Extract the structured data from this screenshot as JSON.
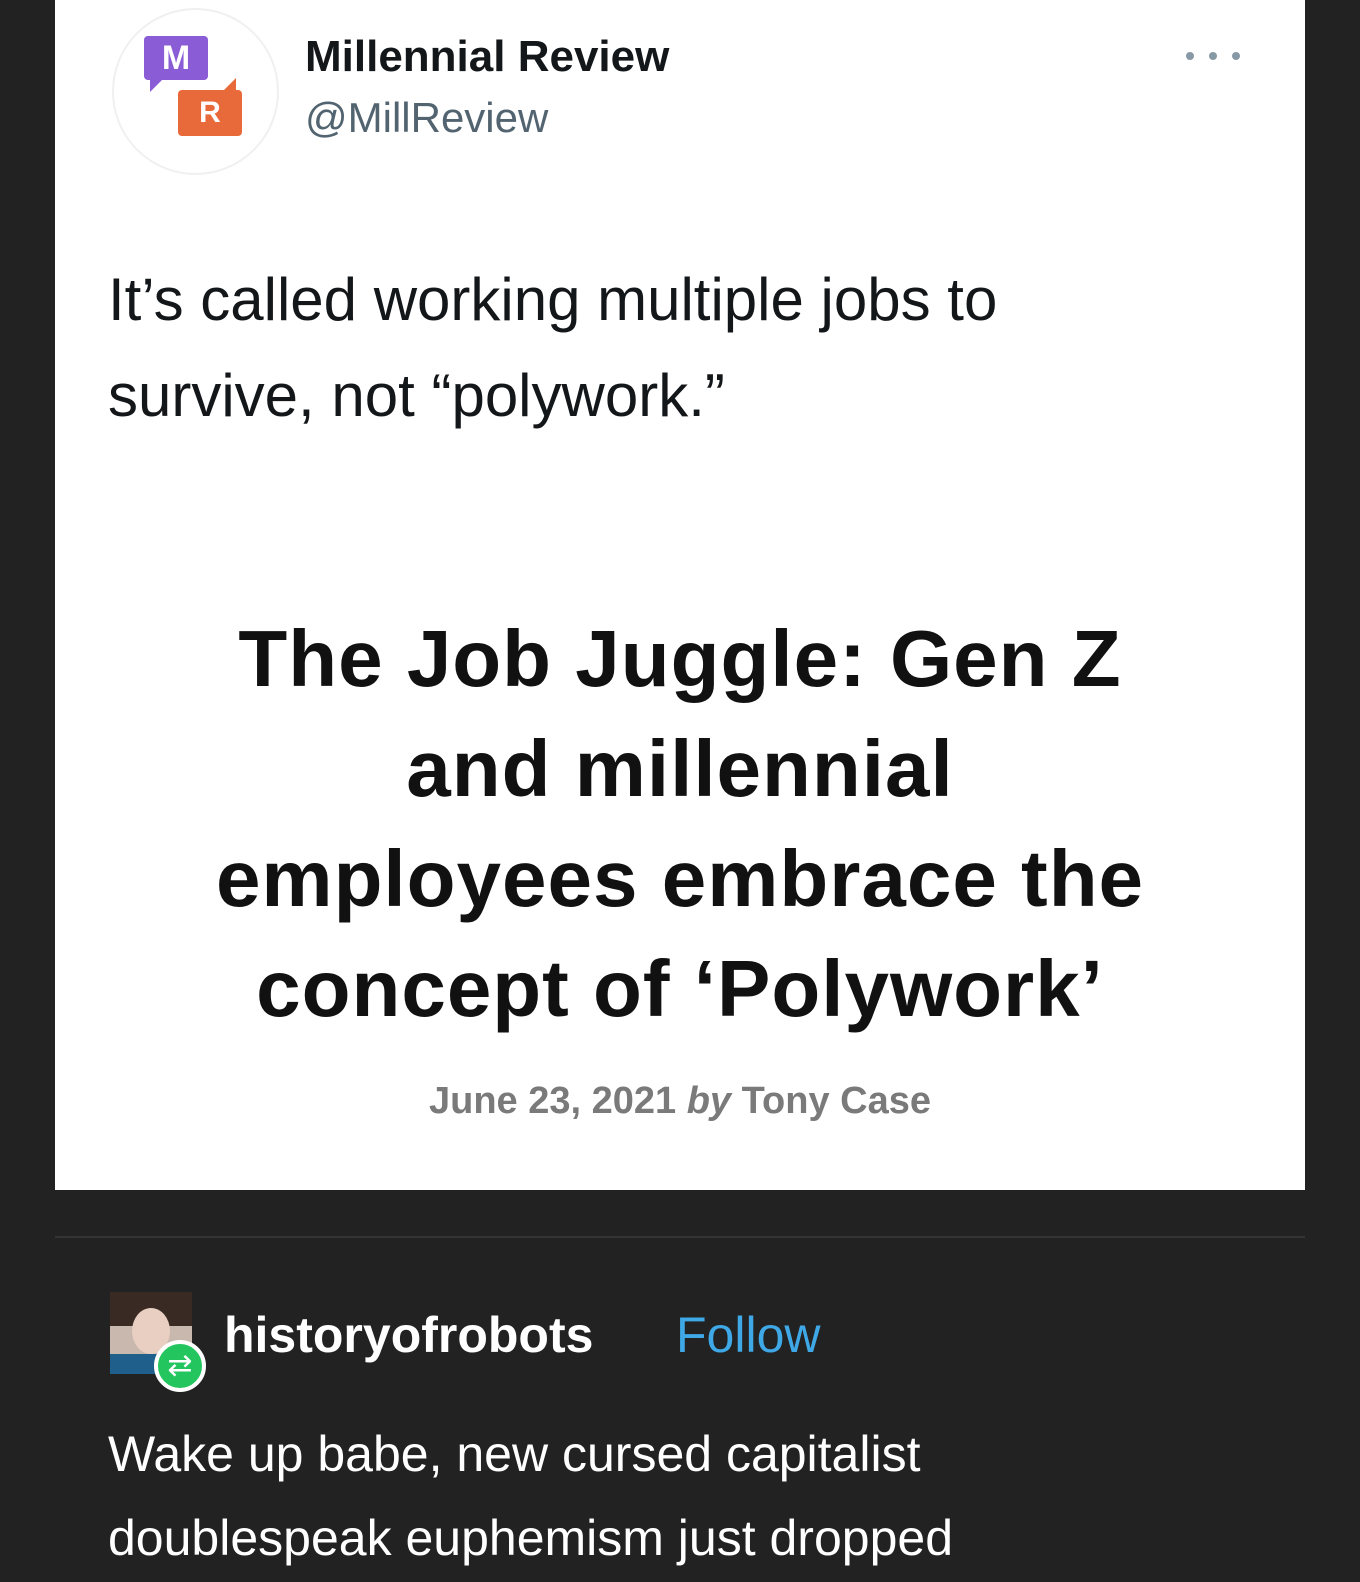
{
  "tweet": {
    "logo": {
      "top_letter": "M",
      "bottom_letter": "R",
      "top_color": "#8a5cd6",
      "bottom_color": "#e86a3a"
    },
    "display_name": "Millennial Review",
    "handle": "@MillReview",
    "more_icon": "more-horizontal-icon",
    "text_line1": "It’s called working multiple jobs to",
    "text_line2": "survive, not “polywork.”"
  },
  "article": {
    "headline_lines": [
      "The Job Juggle: Gen Z",
      "and millennial",
      "employees embrace the",
      "concept of ‘Polywork’"
    ],
    "date": "June 23, 2021",
    "by": "by",
    "author": "Tony Case"
  },
  "reblog": {
    "avatar": "user-avatar",
    "badge_icon": "reblog-icon",
    "username": "historyofrobots",
    "follow_label": "Follow",
    "follow_color": "#3fa8e6",
    "text_line1": "Wake up babe, new cursed capitalist",
    "text_line2": "doublespeak euphemism just dropped"
  }
}
